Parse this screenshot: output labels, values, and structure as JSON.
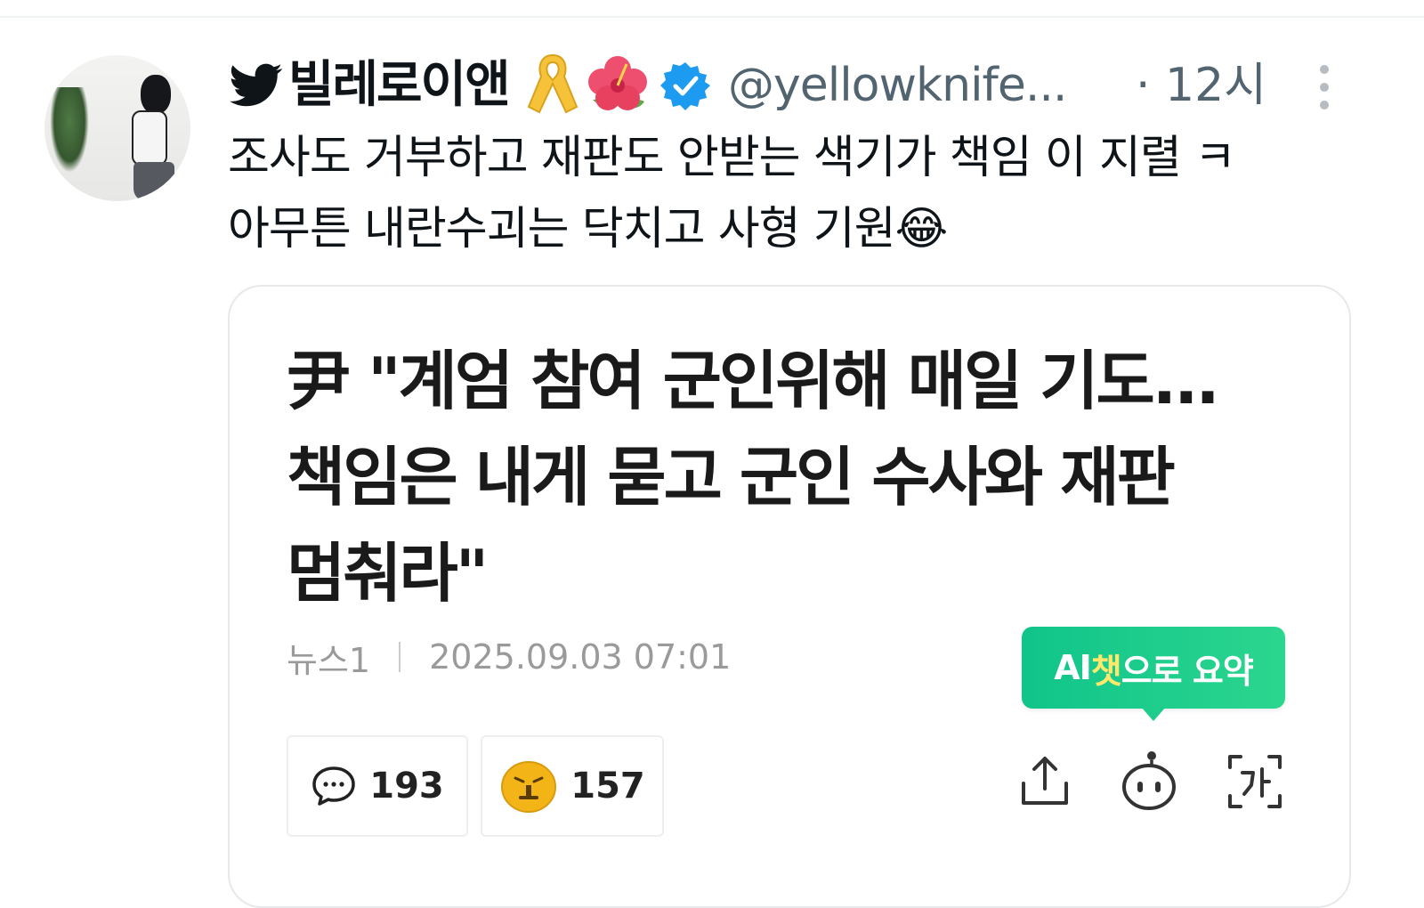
{
  "tweet": {
    "display_name": "빌레로이앤",
    "handle": "@yellowknife...",
    "timestamp": "· 12시",
    "text_lines": [
      "조사도 거부하고 재판도 안받는 색기가 책임 이 지렬 ㅋ",
      "아무튼 내란수괴는 닥치고 사형 기원😂"
    ]
  },
  "card": {
    "title_lines": [
      "尹 \"계엄 참여 군인위해 매일 기도...",
      "책임은 내게 묻고 군인 수사와 재판",
      "멈춰라\""
    ],
    "source": "뉴스1",
    "datetime": "2025.09.03 07:01",
    "ai_button": {
      "prefix": "AI",
      "accent": "챗",
      "suffix": "으로 요약"
    },
    "comment_count": "193",
    "reaction_count": "157"
  },
  "icons": {
    "bird": "twitter-bird-icon",
    "ribbon": "yellow-ribbon-icon",
    "hibiscus": "hibiscus-icon",
    "verified": "verified-badge-icon",
    "more": "more-vertical-icon",
    "comment": "comment-icon",
    "reaction": "angry-face-icon",
    "share": "share-icon",
    "bot": "ai-bot-icon",
    "font": "font-size-icon"
  },
  "colors": {
    "text": "#0f1419",
    "secondary": "#536471",
    "verified": "#1d9bf0",
    "ai_green": "#1ccd8c",
    "ribbon_yellow": "#f5c23a",
    "reaction_yellow": "#f2b417"
  }
}
